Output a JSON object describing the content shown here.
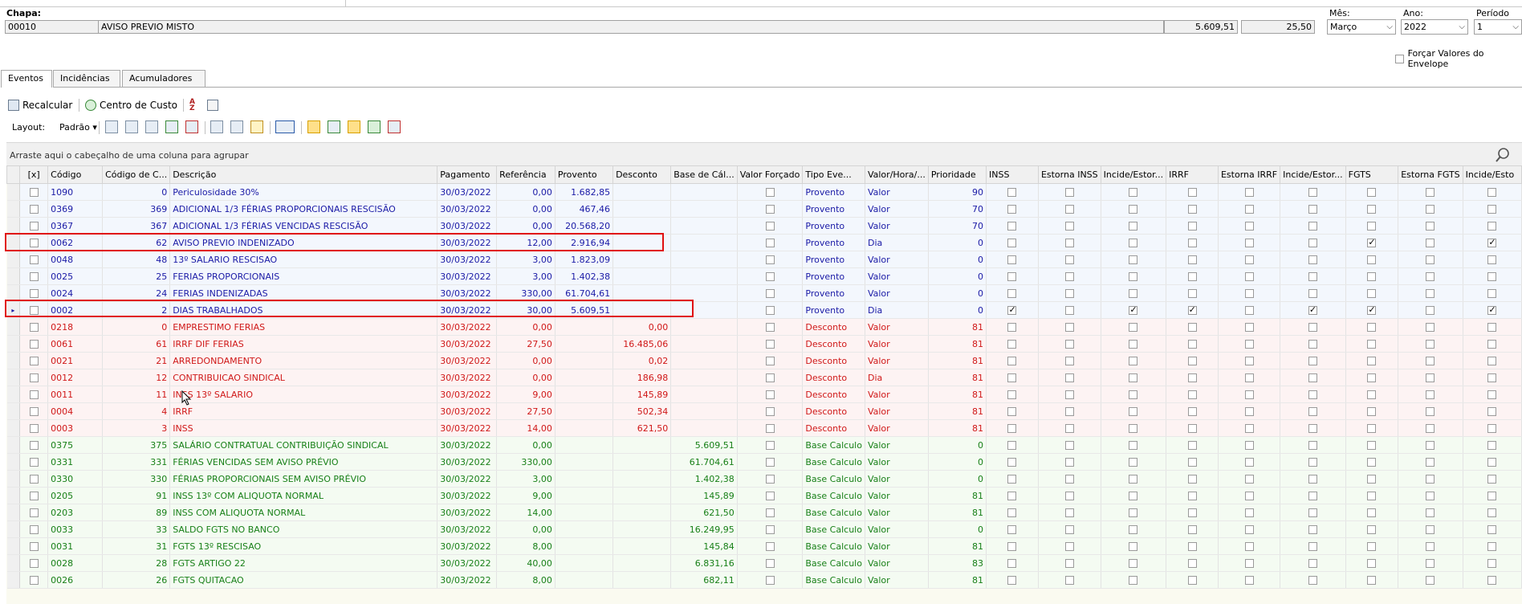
{
  "header": {
    "chapa_label": "Chapa:",
    "chapa_code": "00010",
    "chapa_name": "AVISO PREVIO MISTO",
    "total_value": "5.609,51",
    "reference": "25,50",
    "mes_label": "Mês:",
    "mes_value": "Março",
    "ano_label": "Ano:",
    "ano_value": "2022",
    "periodo_label": "Período",
    "periodo_value": "1",
    "forcar_label": "Forçar Valores do Envelope"
  },
  "tabs": [
    {
      "label": "Eventos"
    },
    {
      "label": "Incidências"
    },
    {
      "label": "Acumuladores"
    }
  ],
  "toolbar": {
    "recalcular": "Recalcular",
    "centro_custo": "Centro de Custo",
    "layout_label": "Layout:",
    "layout_value": "Padrão"
  },
  "grid": {
    "group_hint": "Arraste aqui o cabeçalho de uma coluna para agrupar",
    "columns": [
      "[x]",
      "Código",
      "Código de C...",
      "Descrição",
      "Pagamento",
      "Referência",
      "Provento",
      "Desconto",
      "Base de Cál...",
      "Valor Forçado",
      "Tipo Eve...",
      "Valor/Hora/...",
      "Prioridade",
      "INSS",
      "Estorna INSS",
      "Incide/Estor...",
      "IRRF",
      "Estorna IRRF",
      "Incide/Estor...",
      "FGTS",
      "Estorna FGTS",
      "Incide/Esto"
    ],
    "rows": [
      {
        "kind": "prov",
        "codigo": "1090",
        "codc": "0",
        "desc": "Periculosidade 30%",
        "pag": "30/03/2022",
        "ref": "0,00",
        "prov": "1.682,85",
        "descv": "",
        "base": "",
        "tipo": "Provento",
        "vh": "Valor",
        "prio": "90",
        "checks": [
          0,
          0,
          0,
          0,
          0,
          0,
          0,
          0,
          0
        ]
      },
      {
        "kind": "prov",
        "codigo": "0369",
        "codc": "369",
        "desc": "ADICIONAL 1/3 FÉRIAS PROPORCIONAIS RESCISÃO",
        "pag": "30/03/2022",
        "ref": "0,00",
        "prov": "467,46",
        "descv": "",
        "base": "",
        "tipo": "Provento",
        "vh": "Valor",
        "prio": "70",
        "checks": [
          0,
          0,
          0,
          0,
          0,
          0,
          0,
          0,
          0
        ]
      },
      {
        "kind": "prov",
        "codigo": "0367",
        "codc": "367",
        "desc": "ADICIONAL 1/3 FÉRIAS VENCIDAS RESCISÃO",
        "pag": "30/03/2022",
        "ref": "0,00",
        "prov": "20.568,20",
        "descv": "",
        "base": "",
        "tipo": "Provento",
        "vh": "Valor",
        "prio": "70",
        "checks": [
          0,
          0,
          0,
          0,
          0,
          0,
          0,
          0,
          0
        ]
      },
      {
        "kind": "prov",
        "codigo": "0062",
        "codc": "62",
        "desc": "AVISO PREVIO INDENIZADO",
        "pag": "30/03/2022",
        "ref": "12,00",
        "prov": "2.916,94",
        "descv": "",
        "base": "",
        "tipo": "Provento",
        "vh": "Dia",
        "prio": "0",
        "checks": [
          0,
          0,
          0,
          0,
          0,
          0,
          1,
          0,
          1
        ]
      },
      {
        "kind": "prov",
        "codigo": "0048",
        "codc": "48",
        "desc": "13º SALARIO RESCISAO",
        "pag": "30/03/2022",
        "ref": "3,00",
        "prov": "1.823,09",
        "descv": "",
        "base": "",
        "tipo": "Provento",
        "vh": "Valor",
        "prio": "0",
        "checks": [
          0,
          0,
          0,
          0,
          0,
          0,
          0,
          0,
          0
        ]
      },
      {
        "kind": "prov",
        "codigo": "0025",
        "codc": "25",
        "desc": "FERIAS PROPORCIONAIS",
        "pag": "30/03/2022",
        "ref": "3,00",
        "prov": "1.402,38",
        "descv": "",
        "base": "",
        "tipo": "Provento",
        "vh": "Valor",
        "prio": "0",
        "checks": [
          0,
          0,
          0,
          0,
          0,
          0,
          0,
          0,
          0
        ]
      },
      {
        "kind": "prov",
        "codigo": "0024",
        "codc": "24",
        "desc": "FERIAS INDENIZADAS",
        "pag": "30/03/2022",
        "ref": "330,00",
        "prov": "61.704,61",
        "descv": "",
        "base": "",
        "tipo": "Provento",
        "vh": "Valor",
        "prio": "0",
        "checks": [
          0,
          0,
          0,
          0,
          0,
          0,
          0,
          0,
          0
        ]
      },
      {
        "kind": "prov",
        "codigo": "0002",
        "codc": "2",
        "desc": "DIAS TRABALHADOS",
        "pag": "30/03/2022",
        "ref": "30,00",
        "prov": "5.609,51",
        "descv": "",
        "base": "",
        "tipo": "Provento",
        "vh": "Dia",
        "prio": "0",
        "checks": [
          1,
          0,
          1,
          1,
          0,
          1,
          1,
          0,
          1
        ],
        "current": true
      },
      {
        "kind": "desc",
        "codigo": "0218",
        "codc": "0",
        "desc": "EMPRESTIMO FERIAS",
        "pag": "30/03/2022",
        "ref": "0,00",
        "prov": "",
        "descv": "0,00",
        "base": "",
        "tipo": "Desconto",
        "vh": "Valor",
        "prio": "81",
        "checks": [
          0,
          0,
          0,
          0,
          0,
          0,
          0,
          0,
          0
        ]
      },
      {
        "kind": "desc",
        "codigo": "0061",
        "codc": "61",
        "desc": "IRRF DIF FERIAS",
        "pag": "30/03/2022",
        "ref": "27,50",
        "prov": "",
        "descv": "16.485,06",
        "base": "",
        "tipo": "Desconto",
        "vh": "Valor",
        "prio": "81",
        "checks": [
          0,
          0,
          0,
          0,
          0,
          0,
          0,
          0,
          0
        ]
      },
      {
        "kind": "desc",
        "codigo": "0021",
        "codc": "21",
        "desc": "ARREDONDAMENTO",
        "pag": "30/03/2022",
        "ref": "0,00",
        "prov": "",
        "descv": "0,02",
        "base": "",
        "tipo": "Desconto",
        "vh": "Valor",
        "prio": "81",
        "checks": [
          0,
          0,
          0,
          0,
          0,
          0,
          0,
          0,
          0
        ]
      },
      {
        "kind": "desc",
        "codigo": "0012",
        "codc": "12",
        "desc": "CONTRIBUICAO SINDICAL",
        "pag": "30/03/2022",
        "ref": "0,00",
        "prov": "",
        "descv": "186,98",
        "base": "",
        "tipo": "Desconto",
        "vh": "Dia",
        "prio": "81",
        "checks": [
          0,
          0,
          0,
          0,
          0,
          0,
          0,
          0,
          0
        ]
      },
      {
        "kind": "desc",
        "codigo": "0011",
        "codc": "11",
        "desc": "INSS 13º SALARIO",
        "pag": "30/03/2022",
        "ref": "9,00",
        "prov": "",
        "descv": "145,89",
        "base": "",
        "tipo": "Desconto",
        "vh": "Valor",
        "prio": "81",
        "checks": [
          0,
          0,
          0,
          0,
          0,
          0,
          0,
          0,
          0
        ]
      },
      {
        "kind": "desc",
        "codigo": "0004",
        "codc": "4",
        "desc": "IRRF",
        "pag": "30/03/2022",
        "ref": "27,50",
        "prov": "",
        "descv": "502,34",
        "base": "",
        "tipo": "Desconto",
        "vh": "Valor",
        "prio": "81",
        "checks": [
          0,
          0,
          0,
          0,
          0,
          0,
          0,
          0,
          0
        ]
      },
      {
        "kind": "desc",
        "codigo": "0003",
        "codc": "3",
        "desc": "INSS",
        "pag": "30/03/2022",
        "ref": "14,00",
        "prov": "",
        "descv": "621,50",
        "base": "",
        "tipo": "Desconto",
        "vh": "Valor",
        "prio": "81",
        "checks": [
          0,
          0,
          0,
          0,
          0,
          0,
          0,
          0,
          0
        ]
      },
      {
        "kind": "base",
        "codigo": "0375",
        "codc": "375",
        "desc": "SALÁRIO CONTRATUAL CONTRIBUIÇÃO SINDICAL",
        "pag": "30/03/2022",
        "ref": "0,00",
        "prov": "",
        "descv": "",
        "base": "5.609,51",
        "tipo": "Base Calculo",
        "vh": "Valor",
        "prio": "0",
        "checks": [
          0,
          0,
          0,
          0,
          0,
          0,
          0,
          0,
          0
        ]
      },
      {
        "kind": "base",
        "codigo": "0331",
        "codc": "331",
        "desc": "FÉRIAS VENCIDAS SEM AVISO PRÉVIO",
        "pag": "30/03/2022",
        "ref": "330,00",
        "prov": "",
        "descv": "",
        "base": "61.704,61",
        "tipo": "Base Calculo",
        "vh": "Valor",
        "prio": "0",
        "checks": [
          0,
          0,
          0,
          0,
          0,
          0,
          0,
          0,
          0
        ]
      },
      {
        "kind": "base",
        "codigo": "0330",
        "codc": "330",
        "desc": "FÉRIAS PROPORCIONAIS SEM AVISO PRÉVIO",
        "pag": "30/03/2022",
        "ref": "3,00",
        "prov": "",
        "descv": "",
        "base": "1.402,38",
        "tipo": "Base Calculo",
        "vh": "Valor",
        "prio": "0",
        "checks": [
          0,
          0,
          0,
          0,
          0,
          0,
          0,
          0,
          0
        ]
      },
      {
        "kind": "base",
        "codigo": "0205",
        "codc": "91",
        "desc": "INSS 13º COM ALIQUOTA NORMAL",
        "pag": "30/03/2022",
        "ref": "9,00",
        "prov": "",
        "descv": "",
        "base": "145,89",
        "tipo": "Base Calculo",
        "vh": "Valor",
        "prio": "81",
        "checks": [
          0,
          0,
          0,
          0,
          0,
          0,
          0,
          0,
          0
        ]
      },
      {
        "kind": "base",
        "codigo": "0203",
        "codc": "89",
        "desc": "INSS COM ALIQUOTA NORMAL",
        "pag": "30/03/2022",
        "ref": "14,00",
        "prov": "",
        "descv": "",
        "base": "621,50",
        "tipo": "Base Calculo",
        "vh": "Valor",
        "prio": "81",
        "checks": [
          0,
          0,
          0,
          0,
          0,
          0,
          0,
          0,
          0
        ]
      },
      {
        "kind": "base",
        "codigo": "0033",
        "codc": "33",
        "desc": "SALDO FGTS NO BANCO",
        "pag": "30/03/2022",
        "ref": "0,00",
        "prov": "",
        "descv": "",
        "base": "16.249,95",
        "tipo": "Base Calculo",
        "vh": "Valor",
        "prio": "0",
        "checks": [
          0,
          0,
          0,
          0,
          0,
          0,
          0,
          0,
          0
        ]
      },
      {
        "kind": "base",
        "codigo": "0031",
        "codc": "31",
        "desc": "FGTS 13º RESCISAO",
        "pag": "30/03/2022",
        "ref": "8,00",
        "prov": "",
        "descv": "",
        "base": "145,84",
        "tipo": "Base Calculo",
        "vh": "Valor",
        "prio": "81",
        "checks": [
          0,
          0,
          0,
          0,
          0,
          0,
          0,
          0,
          0
        ]
      },
      {
        "kind": "base",
        "codigo": "0028",
        "codc": "28",
        "desc": "FGTS ARTIGO 22",
        "pag": "30/03/2022",
        "ref": "40,00",
        "prov": "",
        "descv": "",
        "base": "6.831,16",
        "tipo": "Base Calculo",
        "vh": "Valor",
        "prio": "83",
        "checks": [
          0,
          0,
          0,
          0,
          0,
          0,
          0,
          0,
          0
        ]
      },
      {
        "kind": "base",
        "codigo": "0026",
        "codc": "26",
        "desc": "FGTS QUITACAO",
        "pag": "30/03/2022",
        "ref": "8,00",
        "prov": "",
        "descv": "",
        "base": "682,11",
        "tipo": "Base Calculo",
        "vh": "Valor",
        "prio": "81",
        "checks": [
          0,
          0,
          0,
          0,
          0,
          0,
          0,
          0,
          0
        ]
      }
    ]
  }
}
